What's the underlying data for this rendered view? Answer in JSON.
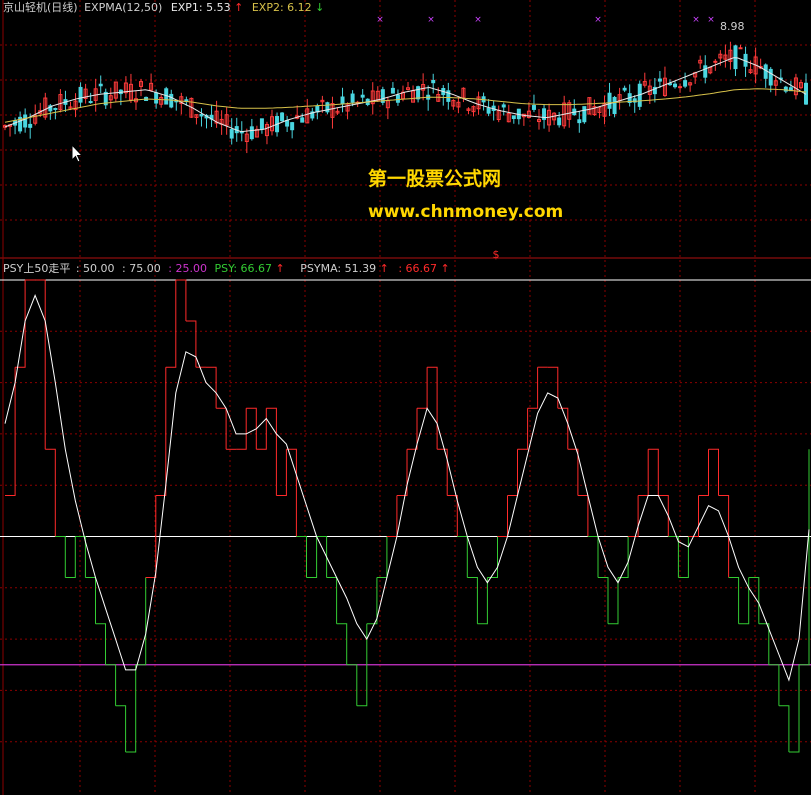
{
  "colors": {
    "background": "#000000",
    "grid": "#8b0000",
    "up_candle": "#ff3b3b",
    "down_candle": "#4ad6e0",
    "exp1_line": "#e8e8e8",
    "exp2_line": "#d8c24a",
    "psy_up": "#ff2a2a",
    "psy_down": "#33cc33",
    "psyma": "#ffffff",
    "level_50": "#ffffff",
    "level_25": "#cc33cc",
    "level_75": "#ffffff",
    "watermark": "#ffd700",
    "label_gray": "#cfcfcf",
    "purple_marker": "#cc44ff"
  },
  "top_panel": {
    "stock_name": "京山轻机(日线)",
    "indicator": "EXPMA(12,50)",
    "exp1_label": "EXP1: 5.53",
    "exp1_arrow": "↑",
    "exp2_label": "EXP2: 6.12",
    "exp2_arrow": "↓",
    "high_label": "8.98"
  },
  "bottom_panel": {
    "indicator_name": "PSY上50走平",
    "level1": ": 50.00",
    "level2": ": 75.00",
    "level3": ": 25.00",
    "psy_label": "PSY: 66.67",
    "psy_arrow": "↑",
    "psyma_label": "PSYMA: 51.39",
    "psyma_arrow": "↑",
    "extra_value": ": 66.67",
    "extra_arrow": "↑"
  },
  "watermark": {
    "title": "第一股票公式网",
    "url": "www.chnmoney.com"
  },
  "chart_data": [
    {
      "type": "candlestick",
      "title": "京山轻机(日线)",
      "series": [
        {
          "name": "EXP1",
          "values": [
            6.8,
            7.0,
            7.25,
            7.4,
            7.5,
            7.55,
            7.6,
            7.45,
            7.2,
            6.9,
            6.7,
            6.75,
            6.95,
            7.1,
            7.2,
            7.3,
            7.4,
            7.55,
            7.65,
            7.5,
            7.3,
            7.15,
            7.05,
            7.0,
            7.1,
            7.2,
            7.35,
            7.5,
            7.7,
            7.9,
            8.1,
            8.3,
            8.1,
            7.8,
            7.5
          ]
        },
        {
          "name": "EXP2",
          "values": [
            6.9,
            7.0,
            7.1,
            7.2,
            7.3,
            7.35,
            7.4,
            7.38,
            7.33,
            7.25,
            7.2,
            7.2,
            7.22,
            7.25,
            7.28,
            7.32,
            7.36,
            7.4,
            7.44,
            7.43,
            7.4,
            7.35,
            7.3,
            7.28,
            7.28,
            7.3,
            7.33,
            7.36,
            7.4,
            7.45,
            7.52,
            7.6,
            7.62,
            7.6,
            7.55
          ]
        }
      ],
      "last_exp1": 5.53,
      "last_exp2": 6.12,
      "annotated_high": 8.98
    },
    {
      "type": "line",
      "title": "PSY上50走平",
      "ylim": [
        0,
        100
      ],
      "levels": [
        50.0,
        75.0,
        25.0
      ],
      "series": [
        {
          "name": "PSY",
          "values": [
            58,
            83,
            100,
            100,
            67,
            50,
            42,
            50,
            42,
            33,
            25,
            17,
            8,
            25,
            42,
            58,
            83,
            100,
            92,
            83,
            83,
            75,
            67,
            67,
            75,
            67,
            75,
            58,
            67,
            50,
            42,
            50,
            42,
            33,
            25,
            17,
            33,
            42,
            50,
            58,
            67,
            75,
            83,
            67,
            58,
            50,
            42,
            33,
            42,
            50,
            58,
            67,
            75,
            83,
            83,
            75,
            67,
            58,
            50,
            42,
            33,
            42,
            50,
            58,
            67,
            58,
            50,
            42,
            50,
            58,
            67,
            58,
            42,
            33,
            42,
            33,
            25,
            17,
            8,
            25,
            67
          ]
        },
        {
          "name": "PSYMA",
          "values": [
            72,
            80,
            92,
            97,
            92,
            80,
            67,
            57,
            49,
            42,
            36,
            30,
            24,
            24,
            31,
            43,
            60,
            78,
            86,
            85,
            80,
            78,
            75,
            70,
            70,
            71,
            73,
            70,
            68,
            62,
            56,
            50,
            46,
            42,
            38,
            33,
            30,
            34,
            42,
            50,
            60,
            68,
            75,
            72,
            65,
            57,
            50,
            44,
            41,
            44,
            50,
            58,
            66,
            74,
            78,
            77,
            72,
            66,
            58,
            50,
            44,
            41,
            45,
            52,
            58,
            58,
            54,
            49,
            48,
            52,
            56,
            55,
            50,
            44,
            40,
            37,
            32,
            27,
            22,
            30,
            51.39
          ]
        }
      ],
      "last_psy": 66.67,
      "last_psyma": 51.39
    }
  ]
}
